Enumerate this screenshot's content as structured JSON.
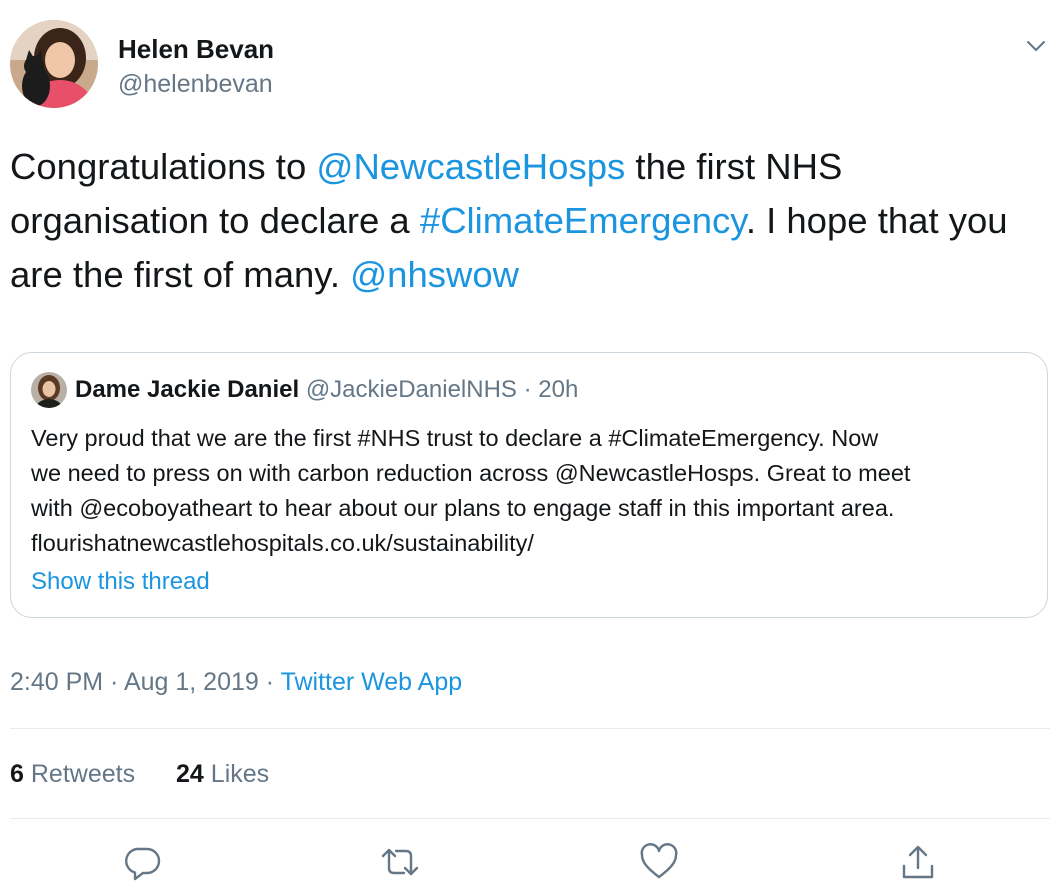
{
  "author": {
    "name": "Helen Bevan",
    "handle": "@helenbevan"
  },
  "tweet": {
    "segments": [
      {
        "text": "Congratulations to "
      },
      {
        "text": "@NewcastleHosps",
        "link": true,
        "name": "mention-newcastlehosps"
      },
      {
        "text": " the first NHS organisation to declare a "
      },
      {
        "text": "#ClimateEmergency",
        "link": true,
        "name": "hashtag-climateemergency"
      },
      {
        "text": ". I hope that you are the first of many. "
      },
      {
        "text": "@nhswow",
        "link": true,
        "name": "mention-nhswow"
      }
    ]
  },
  "quoted": {
    "name": "Dame Jackie Daniel",
    "handle": "@JackieDanielNHS",
    "separator": " · ",
    "time": "20h",
    "lines": [
      "Very proud that we are the first #NHS trust to declare a #ClimateEmergency. Now",
      "we need to press on with carbon reduction across @NewcastleHosps. Great to meet",
      "with @ecoboyatheart to hear about our plans to engage staff in this important area.",
      "flourishatnewcastlehospitals.co.uk/sustainability/"
    ],
    "show_thread": "Show this thread"
  },
  "meta": {
    "time": "2:40 PM",
    "date": "Aug 1, 2019",
    "separator": " · ",
    "source": "Twitter Web App"
  },
  "stats": {
    "retweets_count": "6",
    "retweets_label": "Retweets",
    "likes_count": "24",
    "likes_label": "Likes"
  },
  "icons": {
    "menu": "chevron-down-icon",
    "reply": "reply-icon",
    "retweet": "retweet-icon",
    "like": "heart-icon",
    "share": "share-icon"
  },
  "colors": {
    "link": "#1b95e0",
    "secondary_text": "#657786",
    "border": "#ccd6dd",
    "divider": "#e6ecf0"
  }
}
